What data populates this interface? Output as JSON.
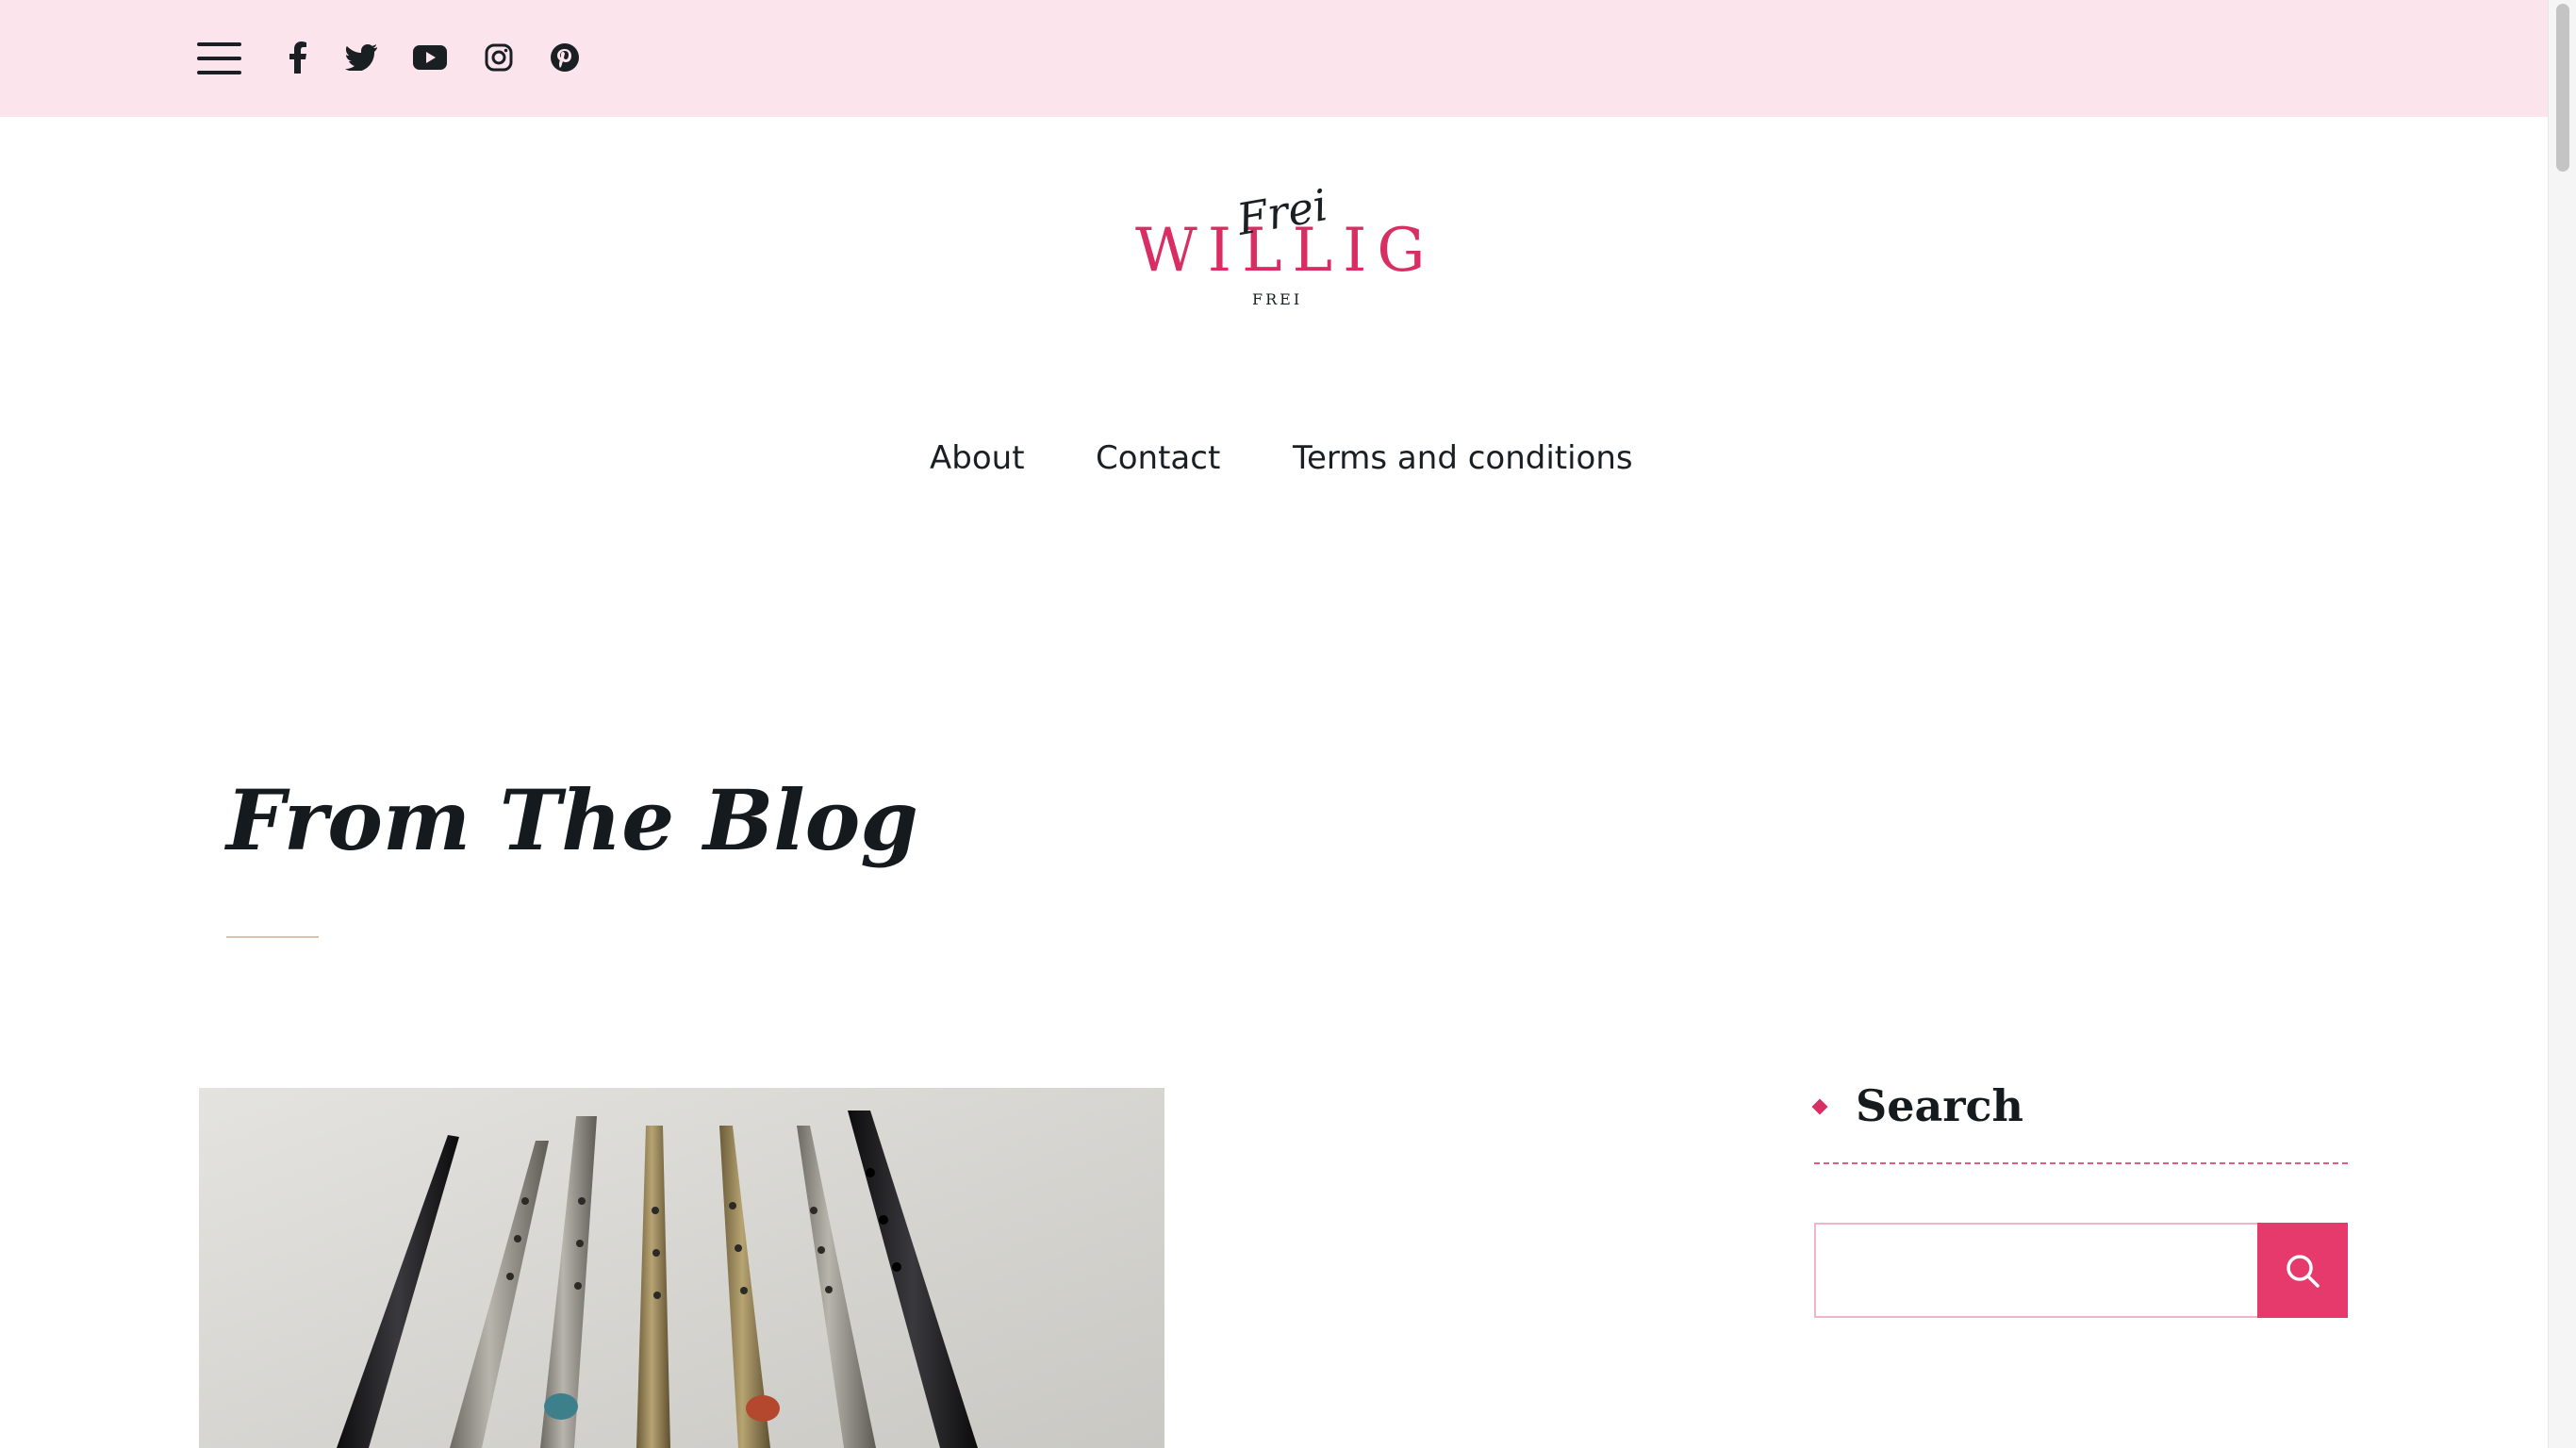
{
  "topbar": {
    "background": "#fbe4ec",
    "menu_icon": "hamburger-menu-icon",
    "social": [
      {
        "name": "facebook",
        "icon": "facebook-icon"
      },
      {
        "name": "twitter",
        "icon": "twitter-icon"
      },
      {
        "name": "youtube",
        "icon": "youtube-icon"
      },
      {
        "name": "instagram",
        "icon": "instagram-icon"
      },
      {
        "name": "pinterest",
        "icon": "pinterest-icon"
      }
    ]
  },
  "logo": {
    "main": "WILLIG",
    "script": "Frei",
    "sub": "FREI",
    "color": "#d92e64"
  },
  "nav": {
    "items": [
      {
        "label": "About"
      },
      {
        "label": "Contact"
      },
      {
        "label": "Terms and conditions"
      }
    ]
  },
  "main": {
    "title": "From The Blog",
    "featured_image": "tin-whistles-photo"
  },
  "sidebar": {
    "search": {
      "title": "Search",
      "input_value": "",
      "button_icon": "search-icon",
      "accent": "#e6396c"
    }
  }
}
